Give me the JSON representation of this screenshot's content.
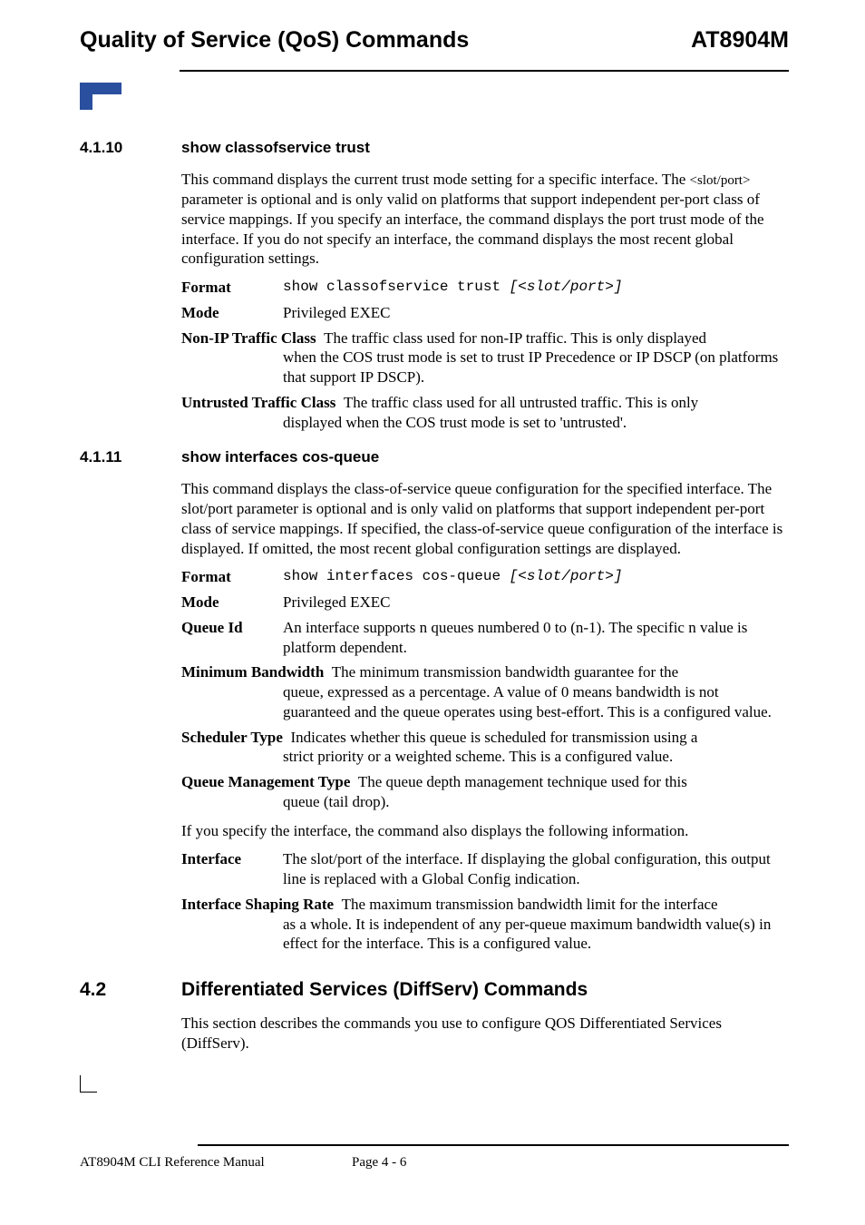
{
  "header": {
    "left": "Quality of Service (QoS) Commands",
    "right": "AT8904M"
  },
  "s4110": {
    "num": "4.1.10",
    "title": "show classofservice trust",
    "intro_a": "This command displays the current trust mode setting for a specific interface. The ",
    "intro_slot": "<slot/port>",
    "intro_b": " parameter is optional and is only valid on platforms that support independent per-port class of service mappings. If you specify an interface, the command displays the port trust mode of the interface. If you do not specify an interface, the command displays the most recent global configuration settings.",
    "format_label": "Format",
    "format_cmd": "show classofservice trust ",
    "format_arg": "[<slot/port>]",
    "mode_label": "Mode",
    "mode_val": "Privileged EXEC",
    "nonip_label": "Non-IP Traffic Class",
    "nonip_val": "  The traffic class used for non-IP traffic. This is only displayed when the COS trust mode is set to trust IP Precedence or IP DSCP (on platforms that support IP DSCP).",
    "untrust_label": "Untrusted Traffic Class",
    "untrust_val": "  The traffic class used for all untrusted traffic. This is only displayed when the COS trust mode is set to 'untrusted'."
  },
  "s4111": {
    "num": "4.1.11",
    "title": "show interfaces cos-queue",
    "intro": "This command displays the class-of-service queue configuration for the specified interface. The slot/port parameter is optional and is only valid on platforms that support independent per-port class of service mappings. If specified, the class-of-service queue configuration of the interface is displayed. If omitted, the most recent global configuration settings are displayed.",
    "format_label": "Format",
    "format_cmd": "show interfaces cos-queue ",
    "format_arg": "[<slot/port>]",
    "mode_label": "Mode",
    "mode_val": "Privileged EXEC",
    "queueid_label": "Queue Id",
    "queueid_val": "An interface supports n queues numbered 0 to (n-1). The specific n value is platform dependent.",
    "minbw_label": "Minimum Bandwidth",
    "minbw_val": "  The minimum transmission bandwidth guarantee for the queue, expressed as a percentage. A value of 0 means bandwidth is not guaranteed and the queue operates using best-effort. This is a configured value.",
    "sched_label": "Scheduler Type",
    "sched_val": "  Indicates whether this queue is scheduled for transmission using a strict priority or a weighted scheme. This is a configured value.",
    "qmgmt_label": "Queue Management Type",
    "qmgmt_val": "  The queue depth management technique used for this queue (tail drop).",
    "ifnote": "If you specify the interface, the command also displays the following information.",
    "iface_label": "Interface",
    "iface_val": "The slot/port of the interface. If displaying the global configuration, this output line is replaced with a Global Config indication.",
    "shape_label": "Interface Shaping Rate",
    "shape_val": "  The maximum transmission bandwidth limit for the interface as a whole. It is independent of any per-queue maximum bandwidth value(s) in effect for the interface. This is a configured value."
  },
  "s42": {
    "num": "4.2",
    "title": "Differentiated Services (DiffServ) Commands",
    "intro": "This section describes the commands you use to configure QOS Differentiated Services (DiffServ)."
  },
  "footer": {
    "left": "AT8904M CLI Reference Manual",
    "mid": "Page 4 - 6"
  }
}
